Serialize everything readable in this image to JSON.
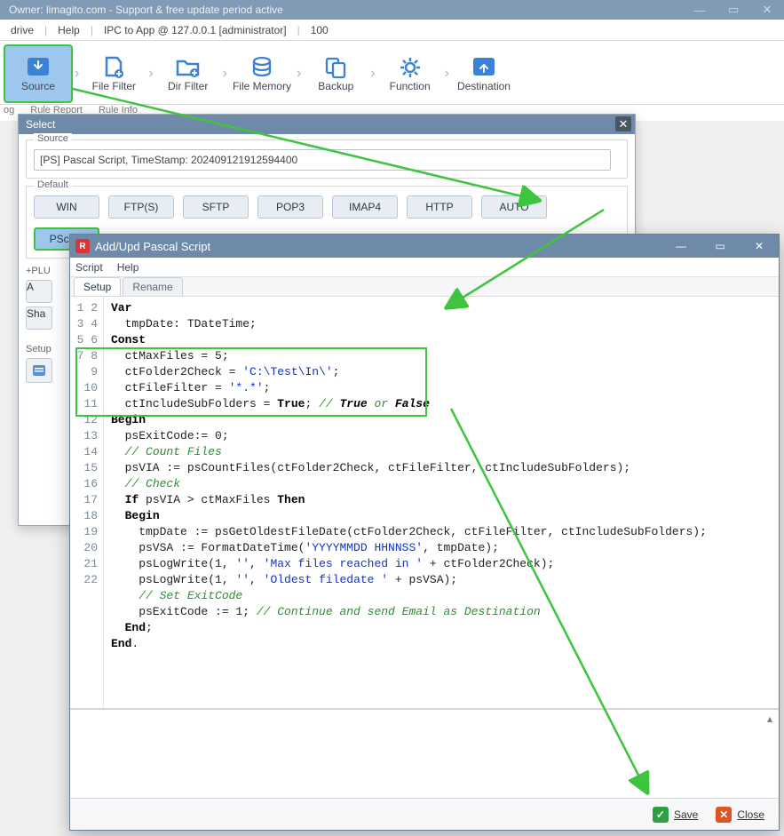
{
  "main_window": {
    "title": "Owner: limagito.com - Support & free update period active",
    "menu": {
      "item1": "drive",
      "item2": "Help",
      "ipc": "IPC to App @ 127.0.0.1 [administrator]",
      "num": "100"
    }
  },
  "ribbon": {
    "source": "Source",
    "filefilter": "File Filter",
    "dirfilter": "Dir Filter",
    "filememory": "File Memory",
    "backup": "Backup",
    "function": "Function",
    "destination": "Destination"
  },
  "subtabs": {
    "t1": "og",
    "t2": "Rule Report",
    "t3": "Rule Info"
  },
  "select_dialog": {
    "title": "Select",
    "source_legend": "Source",
    "source_value": "[PS] Pascal Script, TimeStamp: 202409121912594400",
    "default_legend": "Default",
    "buttons": {
      "win": "WIN",
      "ftps": "FTP(S)",
      "sftp": "SFTP",
      "pop3": "POP3",
      "imap4": "IMAP4",
      "http": "HTTP",
      "auto": "AUTO",
      "pscript": "PScript"
    },
    "plu": "+PLU",
    "small1": "A",
    "small2": "Sha",
    "setup_label": "Setup"
  },
  "script_dialog": {
    "title": "Add/Upd Pascal Script",
    "menu": {
      "script": "Script",
      "help": "Help"
    },
    "tabs": {
      "setup": "Setup",
      "rename": "Rename"
    },
    "footer": {
      "save": "Save",
      "close": "Close"
    },
    "code_lines": [
      "Var",
      "  tmpDate: TDateTime;",
      "Const",
      "  ctMaxFiles = 5;",
      "  ctFolder2Check = 'C:\\Test\\In\\';",
      "  ctFileFilter = '*.*';",
      "  ctIncludeSubFolders = True; // True or False",
      "Begin",
      "  psExitCode:= 0;",
      "  // Count Files",
      "  psVIA := psCountFiles(ctFolder2Check, ctFileFilter, ctIncludeSubFolders);",
      "  // Check",
      "  If psVIA > ctMaxFiles Then",
      "  Begin",
      "    tmpDate := psGetOldestFileDate(ctFolder2Check, ctFileFilter, ctIncludeSubFolders);",
      "    psVSA := FormatDateTime('YYYYMMDD HHNNSS', tmpDate);",
      "    psLogWrite(1, '', 'Max files reached in ' + ctFolder2Check);",
      "    psLogWrite(1, '', 'Oldest filedate ' + psVSA);",
      "    // Set ExitCode",
      "    psExitCode := 1; // Continue and send Email as Destination",
      "  End;",
      "End."
    ]
  }
}
